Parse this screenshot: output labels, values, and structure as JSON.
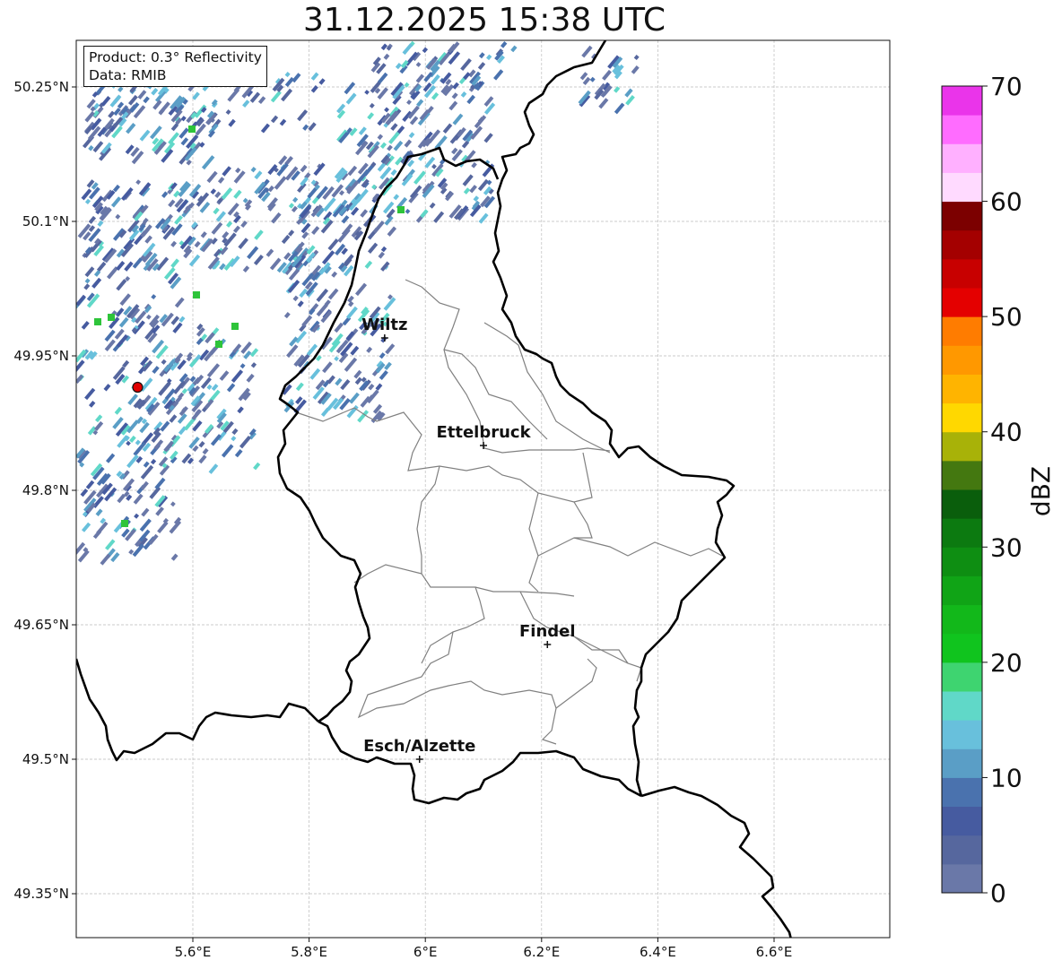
{
  "title": "31.12.2025 15:38 UTC",
  "info_box": {
    "product": "Product: 0.3° Reflectivity",
    "data": "Data: RMIB"
  },
  "map": {
    "lon_range": [
      5.4,
      6.8
    ],
    "lat_range": [
      49.3,
      50.3
    ],
    "x_ticks": [
      {
        "value": 5.6,
        "label": "5.6°E"
      },
      {
        "value": 5.8,
        "label": "5.8°E"
      },
      {
        "value": 6.0,
        "label": "6°E"
      },
      {
        "value": 6.2,
        "label": "6.2°E"
      },
      {
        "value": 6.4,
        "label": "6.4°E"
      },
      {
        "value": 6.6,
        "label": "6.6°E"
      }
    ],
    "y_ticks": [
      {
        "value": 49.35,
        "label": "49.35°N"
      },
      {
        "value": 49.5,
        "label": "49.5°N"
      },
      {
        "value": 49.65,
        "label": "49.65°N"
      },
      {
        "value": 49.8,
        "label": "49.8°N"
      },
      {
        "value": 49.95,
        "label": "49.95°N"
      },
      {
        "value": 50.1,
        "label": "50.1°N"
      },
      {
        "value": 50.25,
        "label": "50.25°N"
      }
    ],
    "grid": true,
    "cities": [
      {
        "name": "Wiltz",
        "lon": 5.93,
        "lat": 49.97
      },
      {
        "name": "Ettelbruck",
        "lon": 6.1,
        "lat": 49.85
      },
      {
        "name": "Findel",
        "lon": 6.21,
        "lat": 49.628
      },
      {
        "name": "Esch/Alzette",
        "lon": 5.99,
        "lat": 49.5
      }
    ],
    "radar_site": {
      "lon": 5.505,
      "lat": 49.915
    }
  },
  "colorbar": {
    "label": "dBZ",
    "min": 0,
    "max": 70,
    "ticks": [
      0,
      10,
      20,
      30,
      40,
      50,
      60,
      70
    ],
    "colors": [
      "#6a78a8",
      "#56679e",
      "#465ba0",
      "#4a72ae",
      "#5a9ec6",
      "#68c0dc",
      "#60d8c8",
      "#3ed470",
      "#10c41e",
      "#12b81a",
      "#10a416",
      "#0e8e12",
      "#0c7a10",
      "#0a5e0c",
      "#447810",
      "#a8b208",
      "#ffd800",
      "#ffb400",
      "#ff9800",
      "#ff7c00",
      "#e40000",
      "#c80000",
      "#a40000",
      "#7c0000",
      "#ffdaff",
      "#ffb0ff",
      "#ff6cff",
      "#ea34ea"
    ]
  },
  "colors": {
    "border": "#000000",
    "canton": "#808080",
    "grid": "#bbbbbb",
    "radar_marker": "#e00000"
  }
}
